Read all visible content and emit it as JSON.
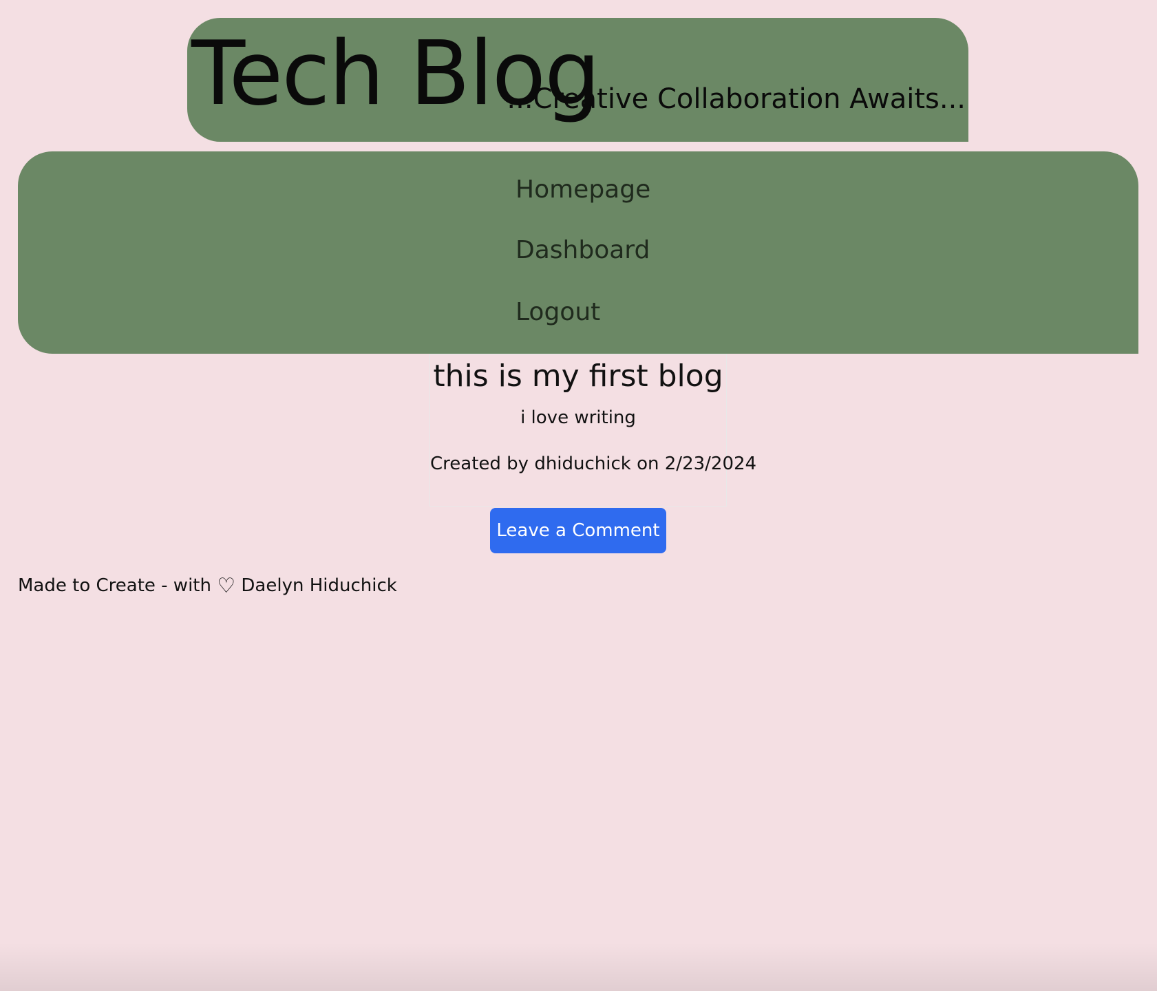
{
  "header": {
    "title": "Tech Blog",
    "tagline": "...Creative Collaboration Awaits..."
  },
  "nav": {
    "items": [
      {
        "label": "Homepage"
      },
      {
        "label": "Dashboard"
      },
      {
        "label": "Logout"
      }
    ]
  },
  "post": {
    "title": "this is my first blog",
    "body": "i love writing",
    "meta": "Created by dhiduchick on 2/23/2024"
  },
  "actions": {
    "comment_label": "Leave a Comment"
  },
  "footer": {
    "prefix": "Made to Create - with",
    "heart": "♡",
    "author": "Daelyn Hiduchick"
  },
  "colors": {
    "background": "#f4dfe3",
    "panel": "#6b8865",
    "button": "#2f6bef"
  },
  "icons": {
    "heart": "heart-icon"
  }
}
